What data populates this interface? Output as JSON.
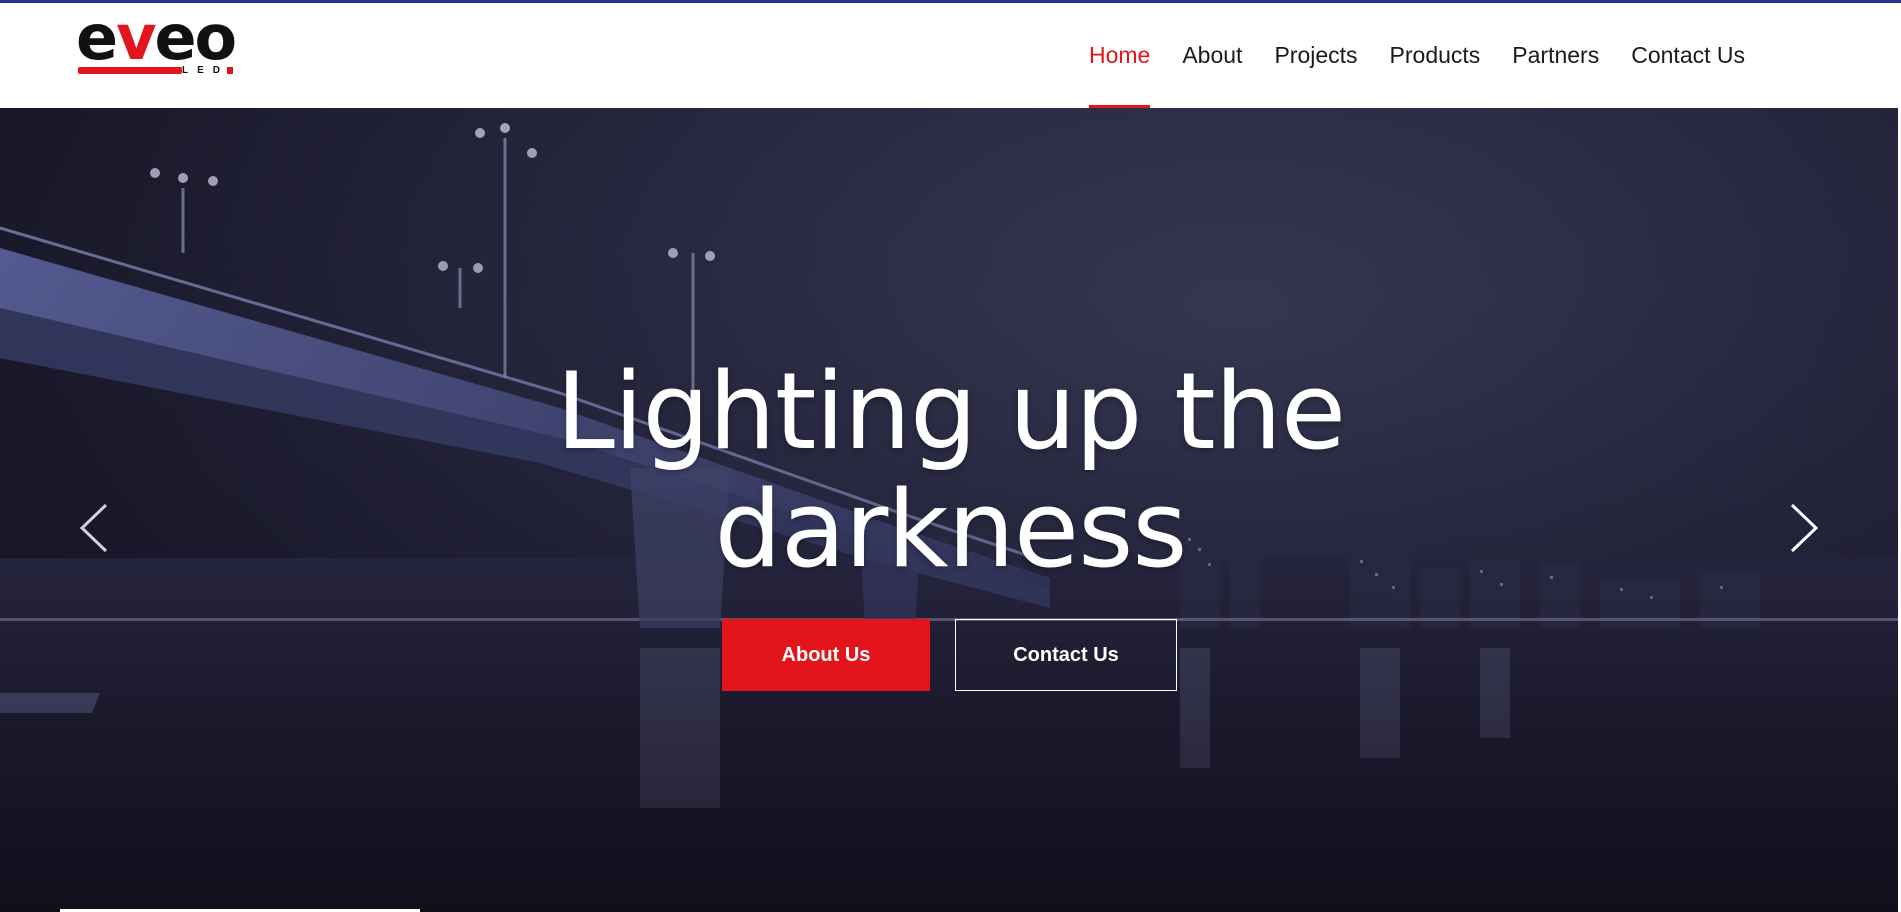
{
  "brand": {
    "logo_text": "eveo",
    "logo_sub": "LED",
    "accent_color": "#e3141b",
    "logo_icon": "eveo-led-logo"
  },
  "nav": {
    "items": [
      {
        "label": "Home",
        "active": true
      },
      {
        "label": "About",
        "active": false
      },
      {
        "label": "Projects",
        "active": false
      },
      {
        "label": "Products",
        "active": false
      },
      {
        "label": "Partners",
        "active": false
      },
      {
        "label": "Contact Us",
        "active": false
      }
    ]
  },
  "hero": {
    "headline_line1": "Lighting up the",
    "headline_line2": "darkness",
    "primary_button": "About Us",
    "secondary_button": "Contact Us",
    "prev_icon": "chevron-left-icon",
    "next_icon": "chevron-right-icon",
    "background_image": "night-bridge-city-skyline"
  }
}
